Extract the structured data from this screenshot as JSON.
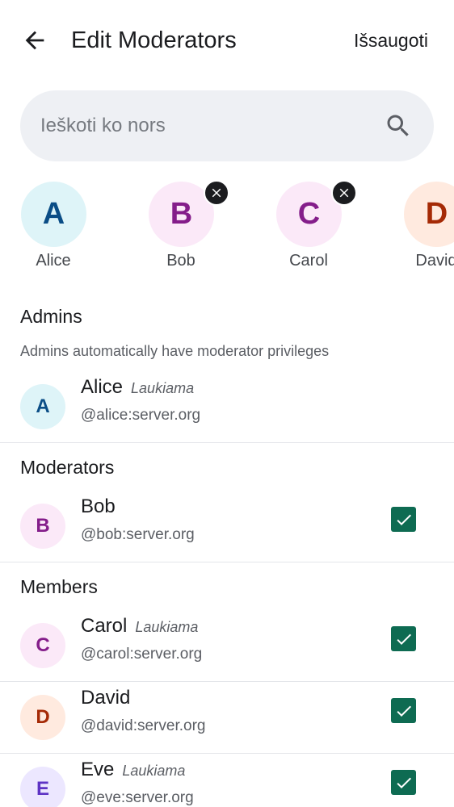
{
  "header": {
    "title": "Edit Moderators",
    "save_label": "Išsaugoti",
    "back_icon": "arrow-left-icon"
  },
  "search": {
    "placeholder": "Ieškoti ko nors",
    "icon": "search-icon"
  },
  "selected_chips": [
    {
      "initial": "A",
      "label": "Alice",
      "removable": false,
      "bg": "#def4f8",
      "fg": "#0a4d86"
    },
    {
      "initial": "B",
      "label": "Bob",
      "removable": true,
      "bg": "#fbe9f8",
      "fg": "#841d8a"
    },
    {
      "initial": "C",
      "label": "Carol",
      "removable": true,
      "bg": "#fbe9f8",
      "fg": "#841d8a"
    },
    {
      "initial": "D",
      "label": "David",
      "removable": true,
      "bg": "#ffeadf",
      "fg": "#a52a06"
    }
  ],
  "sections": {
    "admins": {
      "title": "Admins",
      "description": "Admins automatically have moderator privileges"
    },
    "moderators": {
      "title": "Moderators"
    },
    "members": {
      "title": "Members"
    }
  },
  "users": {
    "alice": {
      "initial": "A",
      "name": "Alice",
      "status": "Laukiama",
      "id": "@alice:server.org",
      "bg": "#def4f8",
      "fg": "#0a4d86"
    },
    "bob": {
      "initial": "B",
      "name": "Bob",
      "id": "@bob:server.org",
      "checked": true,
      "bg": "#fbe9f8",
      "fg": "#841d8a"
    },
    "carol": {
      "initial": "C",
      "name": "Carol",
      "status": "Laukiama",
      "id": "@carol:server.org",
      "checked": true,
      "bg": "#fbe9f8",
      "fg": "#841d8a"
    },
    "david": {
      "initial": "D",
      "name": "David",
      "id": "@david:server.org",
      "checked": true,
      "bg": "#ffeadf",
      "fg": "#a52a06"
    },
    "eve": {
      "initial": "E",
      "name": "Eve",
      "status": "Laukiama",
      "id": "@eve:server.org",
      "checked": true,
      "bg": "#ece7ff",
      "fg": "#5d33c4"
    }
  },
  "colors": {
    "checkbox": "#0e6b52",
    "search_bg": "#eef0f4",
    "divider": "#e4e6ea"
  }
}
